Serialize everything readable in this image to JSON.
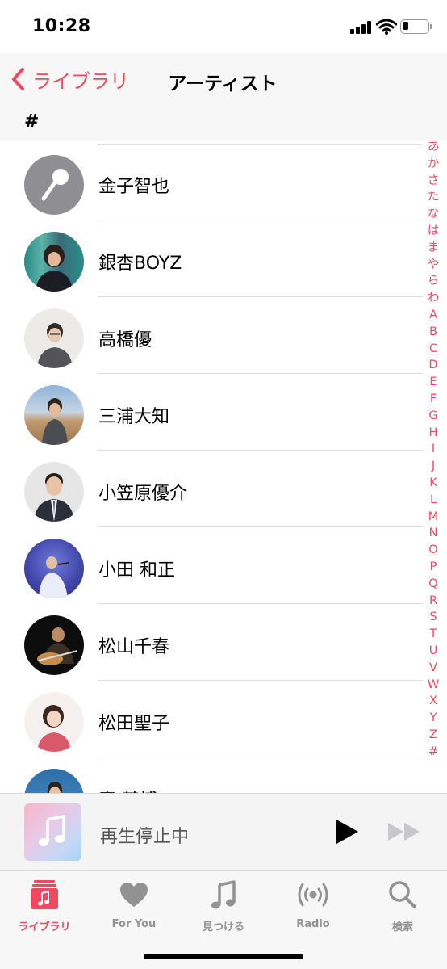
{
  "status_bar": {
    "time": "10:28"
  },
  "nav": {
    "back_label": "ライブラリ",
    "title": "アーティスト",
    "section": "#"
  },
  "artists": [
    {
      "name": "金子智也",
      "avatar": "microphone-icon"
    },
    {
      "name": "銀杏BOYZ",
      "avatar": "photo"
    },
    {
      "name": "高橋優",
      "avatar": "photo"
    },
    {
      "name": "三浦大知",
      "avatar": "photo"
    },
    {
      "name": "小笠原優介",
      "avatar": "photo"
    },
    {
      "name": "小田 和正",
      "avatar": "photo"
    },
    {
      "name": "松山千春",
      "avatar": "photo"
    },
    {
      "name": "松田聖子",
      "avatar": "photo"
    },
    {
      "name": "秦 基博",
      "avatar": "photo"
    }
  ],
  "index": [
    "あ",
    "か",
    "さ",
    "た",
    "な",
    "は",
    "ま",
    "や",
    "ら",
    "わ",
    "A",
    "B",
    "C",
    "D",
    "E",
    "F",
    "G",
    "H",
    "I",
    "J",
    "K",
    "L",
    "M",
    "N",
    "O",
    "P",
    "Q",
    "R",
    "S",
    "T",
    "U",
    "V",
    "W",
    "X",
    "Y",
    "Z",
    "#"
  ],
  "mini_player": {
    "status": "再生停止中"
  },
  "tabs": [
    {
      "label": "ライブラリ",
      "icon": "library-icon",
      "active": true
    },
    {
      "label": "For You",
      "icon": "heart-icon",
      "active": false
    },
    {
      "label": "見つける",
      "icon": "music-note-icon",
      "active": false
    },
    {
      "label": "Radio",
      "icon": "radio-icon",
      "active": false
    },
    {
      "label": "検索",
      "icon": "search-icon",
      "active": false
    }
  ],
  "colors": {
    "accent": "#f2475f",
    "inactive": "#929292",
    "separator": "#dcdcdc"
  }
}
